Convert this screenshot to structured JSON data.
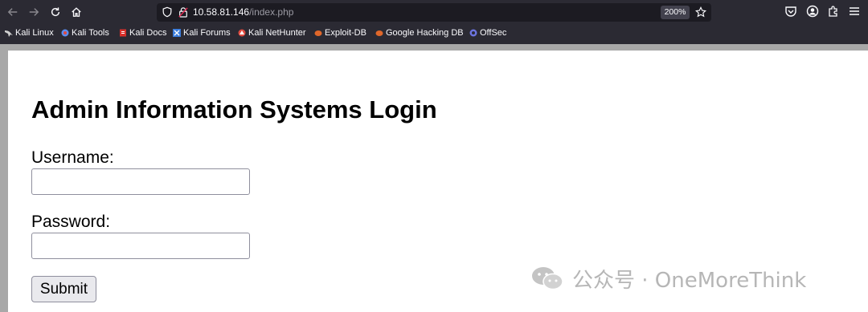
{
  "browser": {
    "url_host": "10.58.81.146",
    "url_path": "/index.php",
    "zoom": "200%"
  },
  "bookmarks": [
    {
      "label": "Kali Linux",
      "icon": "kali-dragon-icon",
      "color": "#cccccc"
    },
    {
      "label": "Kali Tools",
      "icon": "kali-tools-icon",
      "color": "#5b8def"
    },
    {
      "label": "Kali Docs",
      "icon": "kali-docs-icon",
      "color": "#d9302b"
    },
    {
      "label": "Kali Forums",
      "icon": "kali-forums-icon",
      "color": "#3b7ddd"
    },
    {
      "label": "Kali NetHunter",
      "icon": "nethunter-icon",
      "color": "#e04a3f"
    },
    {
      "label": "Exploit-DB",
      "icon": "exploit-db-icon",
      "color": "#e0672a"
    },
    {
      "label": "Google Hacking DB",
      "icon": "ghdb-icon",
      "color": "#e0672a"
    },
    {
      "label": "OffSec",
      "icon": "offsec-icon",
      "color": "#6c74e0"
    }
  ],
  "page": {
    "title": "Admin Information Systems Login",
    "username_label": "Username:",
    "username_value": "",
    "password_label": "Password:",
    "password_value": "",
    "submit_label": "Submit"
  },
  "watermark": {
    "text": "公众号 · OneMoreThink"
  }
}
